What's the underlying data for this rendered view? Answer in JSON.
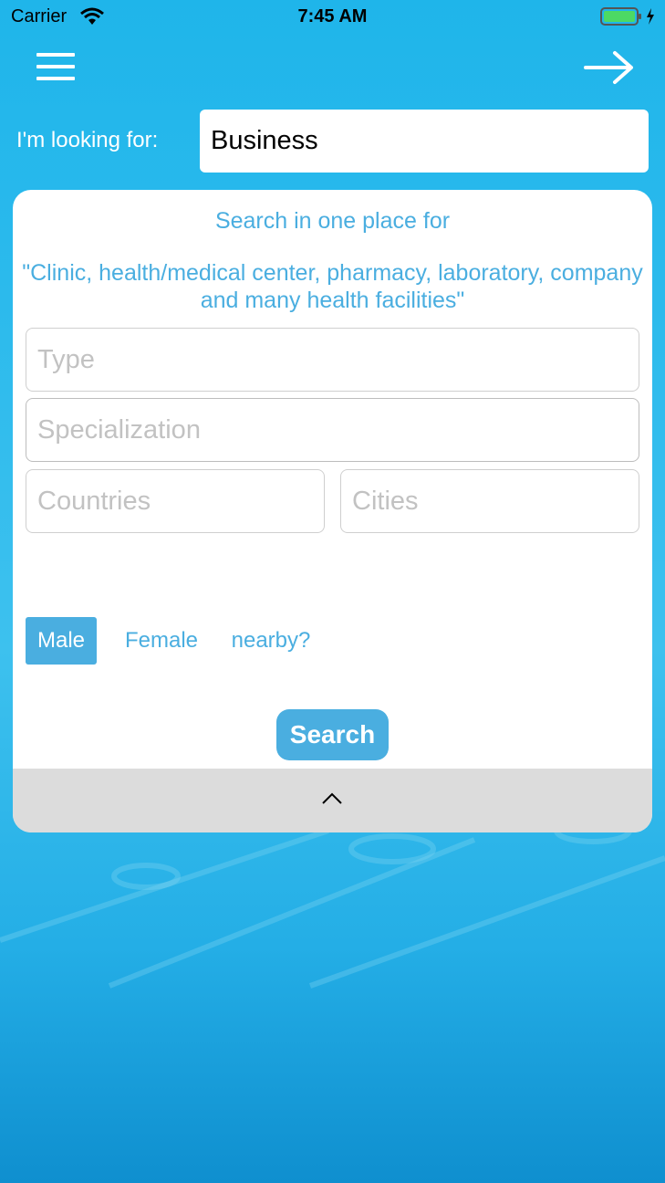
{
  "status_bar": {
    "carrier": "Carrier",
    "time": "7:45 AM",
    "wifi_icon": "wifi-icon",
    "battery_icon": "battery-charging-icon",
    "battery_color": "#4cd964"
  },
  "nav": {
    "menu_icon": "menu-icon",
    "forward_icon": "arrow-right-icon"
  },
  "looking_for": {
    "label": "I'm looking for:",
    "value": "Business"
  },
  "card": {
    "title": "Search in one place for",
    "subtitle": "\"Clinic, health/medical center, pharmacy, laboratory, company and many health facilities\"",
    "fields": {
      "type_placeholder": "Type",
      "specialization_placeholder": "Specialization",
      "countries_placeholder": "Countries",
      "cities_placeholder": "Cities"
    },
    "options": {
      "male": "Male",
      "female": "Female",
      "nearby": "nearby?",
      "selected": "Male"
    },
    "search_button": "Search",
    "collapse_icon": "chevron-up-icon"
  },
  "colors": {
    "accent": "#4aaee0",
    "header_blue": "#1fb5ea",
    "collapse_bar": "#dcdcdc"
  }
}
